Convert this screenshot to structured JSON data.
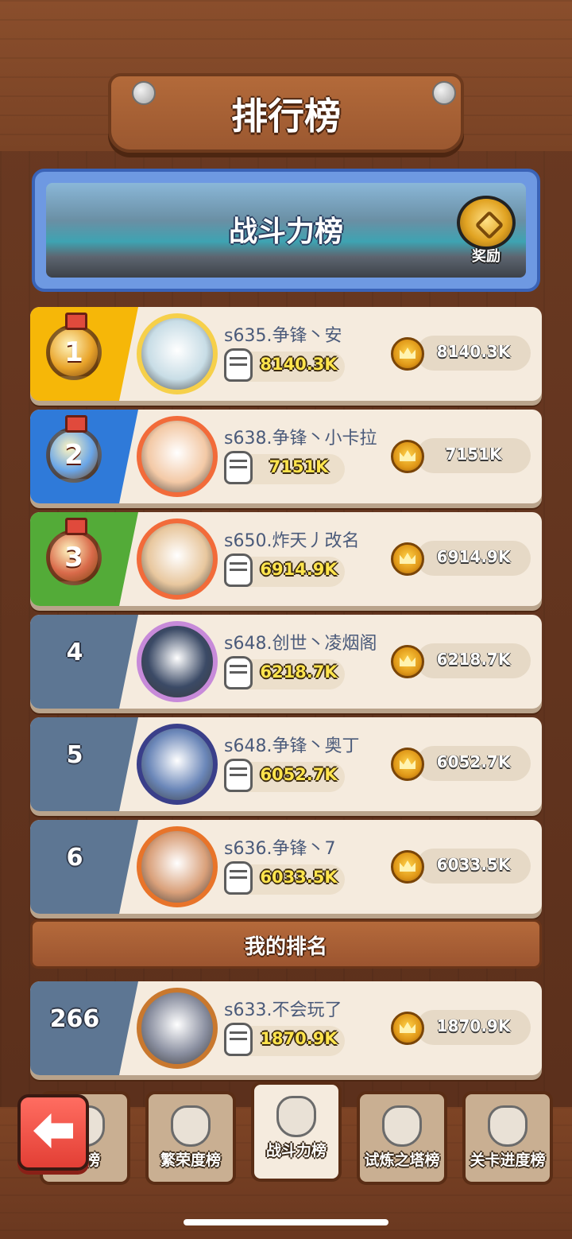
{
  "header": {
    "title": "排行榜"
  },
  "banner": {
    "title": "战斗力榜",
    "reward_label": "奖励",
    "reward_icon": "chest-icon"
  },
  "rows": [
    {
      "rank": "1",
      "medal": true,
      "panel_color": "#f6b708",
      "medal_color": "#e9a42a",
      "avatar_border": "#f6d04a",
      "avatar_bg": "#c8dde6",
      "name": "s635.争锋丶安",
      "power": "8140.3K",
      "score": "8140.3K"
    },
    {
      "rank": "2",
      "medal": true,
      "panel_color": "#2f7ad9",
      "medal_color": "#6aa6e8",
      "avatar_border": "#f26b3a",
      "avatar_bg": "#f3c9a6",
      "name": "s638.争锋丶小卡拉",
      "power": "7151K",
      "score": "7151K"
    },
    {
      "rank": "3",
      "medal": true,
      "panel_color": "#53ab38",
      "medal_color": "#d96a4a",
      "avatar_border": "#f26b3a",
      "avatar_bg": "#e8c79e",
      "name": "s650.炸天丿改名",
      "power": "6914.9K",
      "score": "6914.9K"
    },
    {
      "rank": "4",
      "medal": false,
      "panel_color": "#5d7693",
      "avatar_border": "#c78ad9",
      "avatar_bg": "#3b4a66",
      "name": "s648.创世丶凌烟阁",
      "power": "6218.7K",
      "score": "6218.7K"
    },
    {
      "rank": "5",
      "medal": false,
      "panel_color": "#5d7693",
      "avatar_border": "#3a3f8a",
      "avatar_bg": "#6a86b8",
      "name": "s648.争锋丶奥丁",
      "power": "6052.7K",
      "score": "6052.7K"
    },
    {
      "rank": "6",
      "medal": false,
      "panel_color": "#5d7693",
      "avatar_border": "#e8742a",
      "avatar_bg": "#d9a07a",
      "name": "s636.争锋丶7",
      "power": "6033.5K",
      "score": "6033.5K"
    }
  ],
  "my_rank": {
    "label": "我的排名",
    "row": {
      "rank": "266",
      "panel_color": "#5d7693",
      "avatar_border": "#c9782e",
      "avatar_bg": "#8a8fa0",
      "name": "s633.不会玩了",
      "power": "1870.9K",
      "score": "1870.9K"
    }
  },
  "tabs": [
    {
      "label": "值榜",
      "icon": "card-icon",
      "active": false
    },
    {
      "label": "繁荣度榜",
      "icon": "city-shield-icon",
      "active": false
    },
    {
      "label": "战斗力榜",
      "icon": "fist-icon",
      "active": true
    },
    {
      "label": "试炼之塔榜",
      "icon": "tower-icon",
      "active": false
    },
    {
      "label": "关卡进度榜",
      "icon": "crown-shield-icon",
      "active": false
    }
  ],
  "colors": {
    "accent_yellow": "#ffe44d",
    "name_text": "#4a5a7a",
    "back_button": "#f04a3f"
  }
}
